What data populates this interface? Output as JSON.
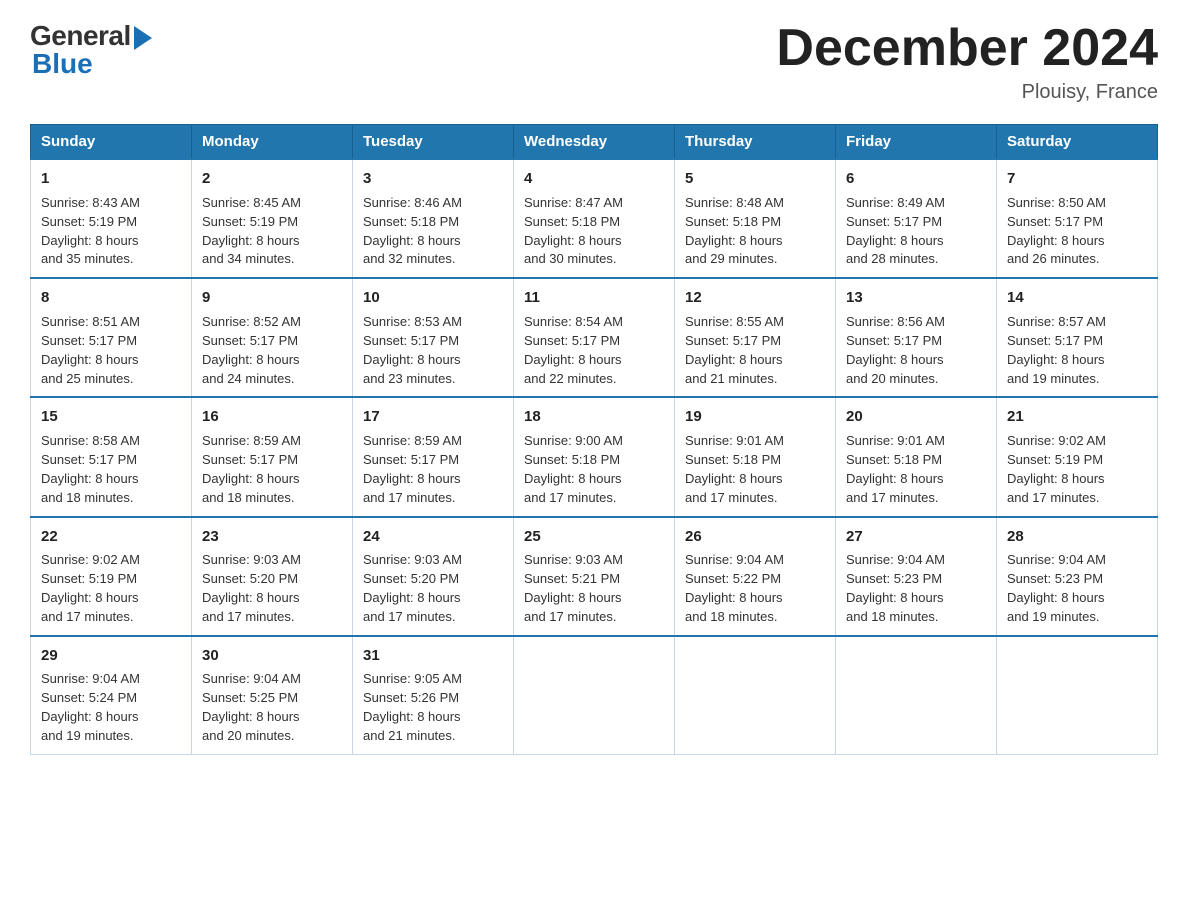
{
  "header": {
    "logo_general": "General",
    "logo_blue": "Blue",
    "title": "December 2024",
    "location": "Plouisy, France"
  },
  "days_of_week": [
    "Sunday",
    "Monday",
    "Tuesday",
    "Wednesday",
    "Thursday",
    "Friday",
    "Saturday"
  ],
  "weeks": [
    [
      {
        "day": "1",
        "sunrise": "8:43 AM",
        "sunset": "5:19 PM",
        "daylight": "8 hours and 35 minutes."
      },
      {
        "day": "2",
        "sunrise": "8:45 AM",
        "sunset": "5:19 PM",
        "daylight": "8 hours and 34 minutes."
      },
      {
        "day": "3",
        "sunrise": "8:46 AM",
        "sunset": "5:18 PM",
        "daylight": "8 hours and 32 minutes."
      },
      {
        "day": "4",
        "sunrise": "8:47 AM",
        "sunset": "5:18 PM",
        "daylight": "8 hours and 30 minutes."
      },
      {
        "day": "5",
        "sunrise": "8:48 AM",
        "sunset": "5:18 PM",
        "daylight": "8 hours and 29 minutes."
      },
      {
        "day": "6",
        "sunrise": "8:49 AM",
        "sunset": "5:17 PM",
        "daylight": "8 hours and 28 minutes."
      },
      {
        "day": "7",
        "sunrise": "8:50 AM",
        "sunset": "5:17 PM",
        "daylight": "8 hours and 26 minutes."
      }
    ],
    [
      {
        "day": "8",
        "sunrise": "8:51 AM",
        "sunset": "5:17 PM",
        "daylight": "8 hours and 25 minutes."
      },
      {
        "day": "9",
        "sunrise": "8:52 AM",
        "sunset": "5:17 PM",
        "daylight": "8 hours and 24 minutes."
      },
      {
        "day": "10",
        "sunrise": "8:53 AM",
        "sunset": "5:17 PM",
        "daylight": "8 hours and 23 minutes."
      },
      {
        "day": "11",
        "sunrise": "8:54 AM",
        "sunset": "5:17 PM",
        "daylight": "8 hours and 22 minutes."
      },
      {
        "day": "12",
        "sunrise": "8:55 AM",
        "sunset": "5:17 PM",
        "daylight": "8 hours and 21 minutes."
      },
      {
        "day": "13",
        "sunrise": "8:56 AM",
        "sunset": "5:17 PM",
        "daylight": "8 hours and 20 minutes."
      },
      {
        "day": "14",
        "sunrise": "8:57 AM",
        "sunset": "5:17 PM",
        "daylight": "8 hours and 19 minutes."
      }
    ],
    [
      {
        "day": "15",
        "sunrise": "8:58 AM",
        "sunset": "5:17 PM",
        "daylight": "8 hours and 18 minutes."
      },
      {
        "day": "16",
        "sunrise": "8:59 AM",
        "sunset": "5:17 PM",
        "daylight": "8 hours and 18 minutes."
      },
      {
        "day": "17",
        "sunrise": "8:59 AM",
        "sunset": "5:17 PM",
        "daylight": "8 hours and 17 minutes."
      },
      {
        "day": "18",
        "sunrise": "9:00 AM",
        "sunset": "5:18 PM",
        "daylight": "8 hours and 17 minutes."
      },
      {
        "day": "19",
        "sunrise": "9:01 AM",
        "sunset": "5:18 PM",
        "daylight": "8 hours and 17 minutes."
      },
      {
        "day": "20",
        "sunrise": "9:01 AM",
        "sunset": "5:18 PM",
        "daylight": "8 hours and 17 minutes."
      },
      {
        "day": "21",
        "sunrise": "9:02 AM",
        "sunset": "5:19 PM",
        "daylight": "8 hours and 17 minutes."
      }
    ],
    [
      {
        "day": "22",
        "sunrise": "9:02 AM",
        "sunset": "5:19 PM",
        "daylight": "8 hours and 17 minutes."
      },
      {
        "day": "23",
        "sunrise": "9:03 AM",
        "sunset": "5:20 PM",
        "daylight": "8 hours and 17 minutes."
      },
      {
        "day": "24",
        "sunrise": "9:03 AM",
        "sunset": "5:20 PM",
        "daylight": "8 hours and 17 minutes."
      },
      {
        "day": "25",
        "sunrise": "9:03 AM",
        "sunset": "5:21 PM",
        "daylight": "8 hours and 17 minutes."
      },
      {
        "day": "26",
        "sunrise": "9:04 AM",
        "sunset": "5:22 PM",
        "daylight": "8 hours and 18 minutes."
      },
      {
        "day": "27",
        "sunrise": "9:04 AM",
        "sunset": "5:23 PM",
        "daylight": "8 hours and 18 minutes."
      },
      {
        "day": "28",
        "sunrise": "9:04 AM",
        "sunset": "5:23 PM",
        "daylight": "8 hours and 19 minutes."
      }
    ],
    [
      {
        "day": "29",
        "sunrise": "9:04 AM",
        "sunset": "5:24 PM",
        "daylight": "8 hours and 19 minutes."
      },
      {
        "day": "30",
        "sunrise": "9:04 AM",
        "sunset": "5:25 PM",
        "daylight": "8 hours and 20 minutes."
      },
      {
        "day": "31",
        "sunrise": "9:05 AM",
        "sunset": "5:26 PM",
        "daylight": "8 hours and 21 minutes."
      },
      null,
      null,
      null,
      null
    ]
  ],
  "labels": {
    "sunrise": "Sunrise:",
    "sunset": "Sunset:",
    "daylight": "Daylight:"
  }
}
